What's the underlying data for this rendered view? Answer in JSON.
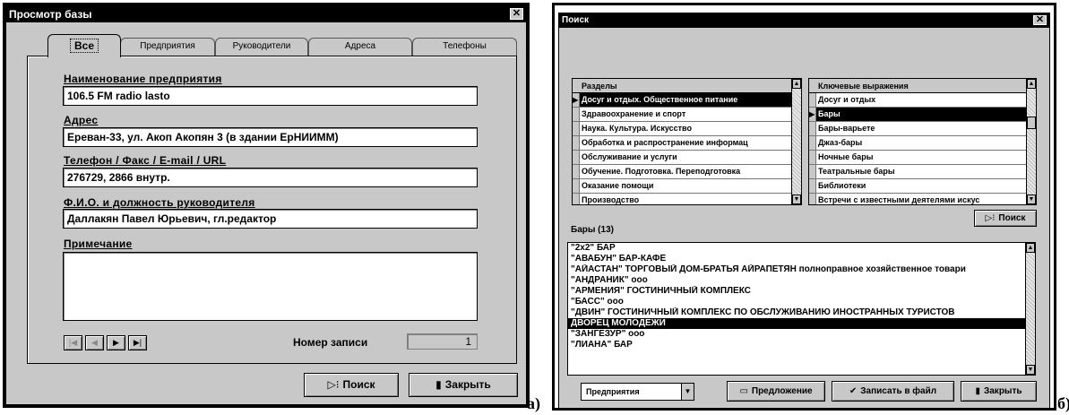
{
  "left_window": {
    "title": "Просмотр базы",
    "close_glyph": "✕",
    "tabs": [
      {
        "label": "Все",
        "active": true
      },
      {
        "label": "Предприятия",
        "active": false
      },
      {
        "label": "Руководители",
        "active": false
      },
      {
        "label": "Адреса",
        "active": false
      },
      {
        "label": "Телефоны",
        "active": false
      }
    ],
    "fields": {
      "name_label": "Наименование предприятия",
      "name_value": "106.5 FM radio lasto",
      "address_label": "Адрес",
      "address_value": "Ереван-33, ул. Акоп Акопян 3 (в здании ЕрНИИММ)",
      "contact_label": "Телефон / Факс / E-mail / URL",
      "contact_value": "276729, 2866 внутр.",
      "head_label": "Ф.И.О. и должность руководителя",
      "head_value": "Даллакян Павел Юрьевич, гл.редактор",
      "note_label": "Примечание",
      "note_value": ""
    },
    "navigator": {
      "first": "|◀",
      "prev": "◀",
      "next": "▶",
      "last": "▶|"
    },
    "record_label": "Номер записи",
    "record_number": "1",
    "search_button": "Поиск",
    "close_button": "Закрыть",
    "icons": {
      "search": "search-icon",
      "close": "exit-icon"
    }
  },
  "left_letter": "а)",
  "right_window": {
    "title": "Поиск",
    "close_glyph": "✕",
    "sections_header": "Разделы",
    "sections": [
      "Досуг и отдых. Общественное питание",
      "Здравоохранение и спорт",
      "Наука. Культура. Искусство",
      "Обработка и распространение информац",
      "Обслуживание и услуги",
      "Обучение. Подготовка. Переподготовка",
      "Оказание помощи",
      "Производство"
    ],
    "sections_selected_index": 0,
    "keywords_header": "Ключевые выражения",
    "keywords": [
      "Досуг и отдых",
      "Бары",
      "Бары-варьете",
      "Джаз-бары",
      "Ночные бары",
      "Театральные бары",
      "Библиотеки",
      "Встречи с известными деятелями искус"
    ],
    "keywords_selected_index": 1,
    "search_button": "Поиск",
    "results_label": "Бары (13)",
    "results": [
      "\"2x2\" БАР",
      "\"АВАБУН\" БАР-КАФЕ",
      "\"АЙАСТАН\" ТОРГОВЫЙ ДОМ-БРАТЬЯ АЙРАПЕТЯН полноправное хозяйственное товари",
      "\"АНДРАНИК\" ооо",
      "\"АРМЕНИЯ\" ГОСТИНИЧНЫЙ КОМПЛЕКС",
      "\"БАСС\" ооо",
      "\"ДВИН\" ГОСТИНИЧНЫЙ КОМПЛЕКС ПО ОБСЛУЖИВАНИЮ ИНОСТРАННЫХ ТУРИСТОВ",
      "ДВОРЕЦ МОЛОДЕЖИ",
      "\"ЗАНГЕЗУР\" ооо",
      "\"ЛИАНА\" БАР"
    ],
    "results_selected_index": 7,
    "filter_value": "Предприятия",
    "proposal_button": "Предложение",
    "save_button": "Записать в файл",
    "close_button": "Закрыть"
  },
  "right_letter": "б)"
}
